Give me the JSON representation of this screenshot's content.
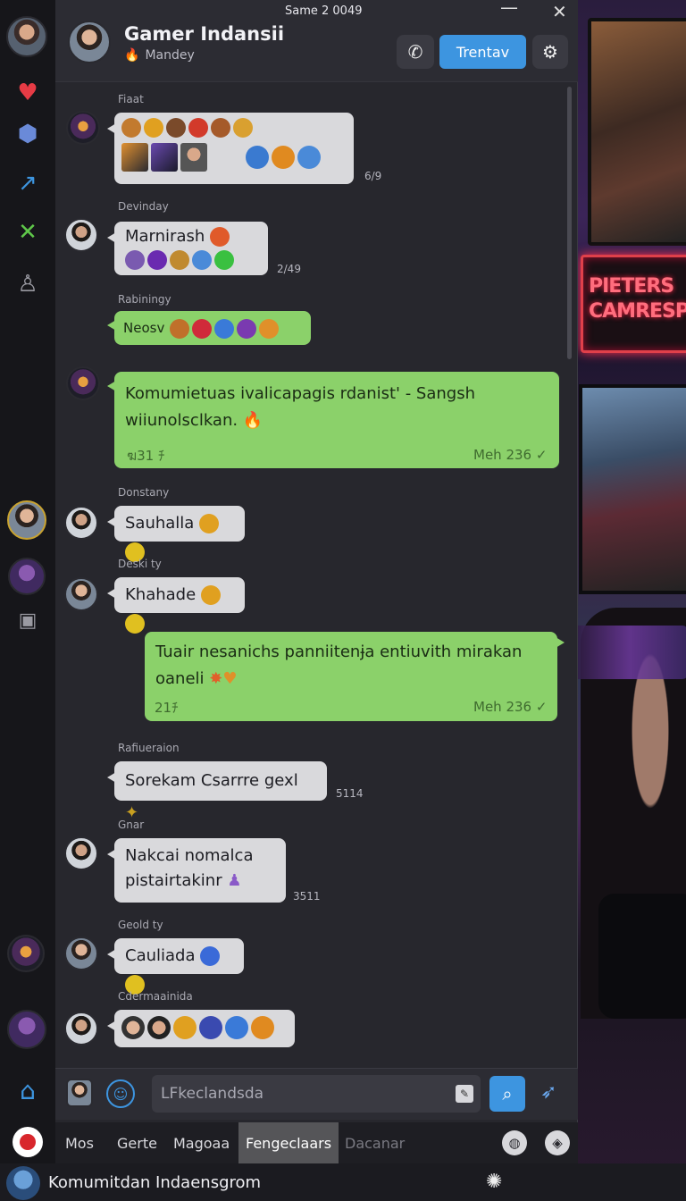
{
  "window": {
    "title": "Same 2 0049",
    "minimize": "—",
    "close": "✕"
  },
  "rail": {
    "icons": [
      "heart-icon",
      "cube-icon",
      "link-icon",
      "close-icon",
      "profile-icon",
      "gamepad-icon"
    ]
  },
  "header": {
    "title": "Gamer Indansii",
    "subtitle": "Mandey",
    "call_icon": "✆",
    "primary_button": "Trentav",
    "settings_icon": "⚙"
  },
  "messages": [
    {
      "sender": "Fiaat",
      "time": "6/9"
    },
    {
      "sender": "Devinday",
      "text": "Marnirash",
      "time": "2/49"
    },
    {
      "sender": "Rabiningy",
      "text": "Neosv"
    },
    {
      "text": "Komumietuas ivalicapagis rdanist' - Sangsh wiiunolsclkan.",
      "left_meta": "ฆ31 ﾁ",
      "time": "Meh 236 ✓"
    },
    {
      "sender": "Donstany",
      "text": "Sauhalla"
    },
    {
      "sender": "Deski ty",
      "text": "Khahade"
    },
    {
      "text": "Tuair nesanichs panniitenɉa entiuvith mirakan oaneli",
      "left_meta": "21ﾁ",
      "time": "Meh 236 ✓"
    },
    {
      "sender": "Rafiueraion",
      "text": "Sorekam Csarrre gexl",
      "time": "5114"
    },
    {
      "sender": "Gnar",
      "text": "Nakcai nomalca pistairtakinr",
      "time": "3511"
    },
    {
      "sender": "Geold ty",
      "text": "Cauliada"
    },
    {
      "sender": "Cdermaainida"
    }
  ],
  "composer": {
    "placeholder": "LFkeclandsda",
    "attach_icon": "✎",
    "search_icon": "⌕",
    "send_icon": "➶",
    "emoji_icon": "☺"
  },
  "tabs": {
    "items": [
      "Mos",
      "Gerte",
      "Magoaa",
      "Fengeclaars",
      "Dacanar"
    ],
    "active_index": 3,
    "globe_icon": "◍",
    "map_icon": "◈"
  },
  "bottom": {
    "name": "Komumitdan Indaensgrom",
    "gear_icon": "✺"
  },
  "scene": {
    "neon_line1": "PIETERS",
    "neon_line2": "CAMRESPR"
  },
  "colors": {
    "accent": "#3d95e0",
    "outgoing": "#8bd16a",
    "incoming": "#d9d9dc",
    "panel": "#27272d"
  }
}
